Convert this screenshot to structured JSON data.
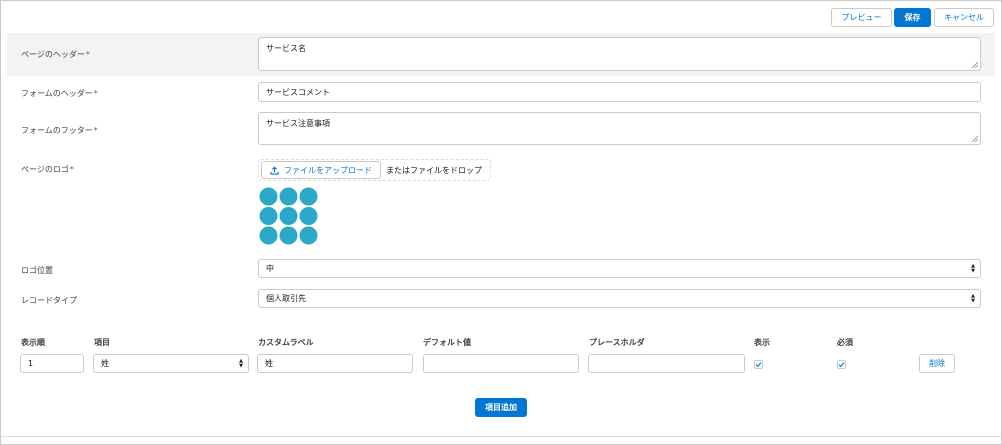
{
  "toolbar": {
    "preview_label": "プレビュー",
    "save_label": "保存",
    "cancel_label": "キャンセル"
  },
  "form": {
    "page_header": {
      "label": "ページのヘッダー",
      "value": "サービス名"
    },
    "form_header": {
      "label": "フォームのヘッダー",
      "value": "サービスコメント"
    },
    "form_footer": {
      "label": "フォームのフッター",
      "value": "サービス注意事項"
    },
    "page_logo": {
      "label": "ページのロゴ",
      "upload_label": "ファイルをアップロード",
      "drop_text": "またはファイルをドロップ",
      "logo_color": "#2ca9c8"
    },
    "logo_position": {
      "label": "ロゴ位置",
      "value": "中"
    },
    "record_type": {
      "label": "レコードタイプ",
      "value": "個人取引先"
    },
    "required_marker": "*"
  },
  "fields_table": {
    "headers": [
      "表示順",
      "項目",
      "カスタムラベル",
      "デフォルト値",
      "プレースホルダ",
      "表示",
      "必須"
    ],
    "rows": [
      {
        "order": "1",
        "field": "姓",
        "custom_label": "姓",
        "default_value": "",
        "placeholder": "",
        "visible": true,
        "required": true,
        "delete_label": "削除"
      }
    ],
    "add_label": "項目追加"
  },
  "colors": {
    "brand": "#0176d3",
    "required": "#c23934",
    "border": "#c9c9c9",
    "row_highlight": "#f3f3f3"
  }
}
